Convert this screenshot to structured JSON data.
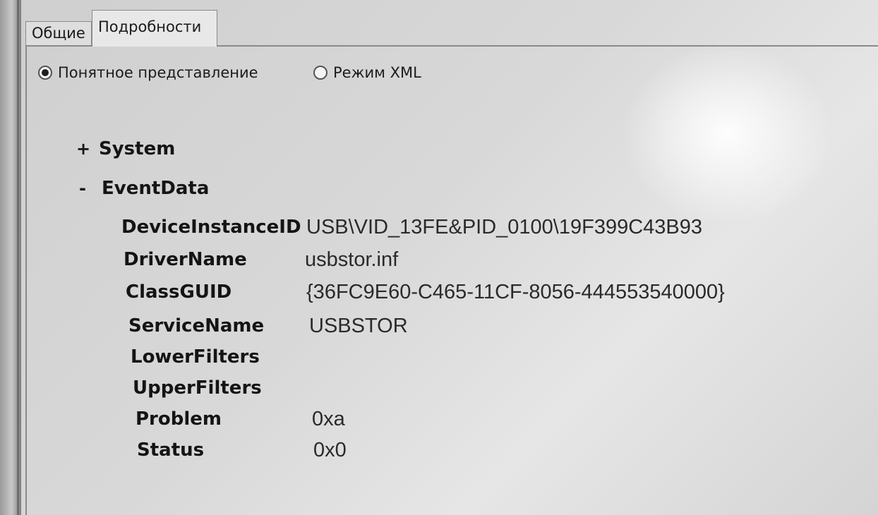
{
  "tabs": {
    "general_label": "Общие",
    "details_label": "Подробности"
  },
  "view_mode": {
    "friendly_label": "Понятное представление",
    "xml_label": "Режим XML",
    "selected": "friendly"
  },
  "tree": {
    "system": {
      "sign": "+",
      "label": "System"
    },
    "eventdata": {
      "sign": "-",
      "label": "EventData",
      "fields": [
        {
          "name": "DeviceInstanceID",
          "value": "USB\\VID_13FE&PID_0100\\19F399C43B93"
        },
        {
          "name": "DriverName",
          "value": "usbstor.inf"
        },
        {
          "name": "ClassGUID",
          "value": "{36FC9E60-C465-11CF-8056-444553540000}"
        },
        {
          "name": "ServiceName",
          "value": "USBSTOR"
        },
        {
          "name": "LowerFilters",
          "value": ""
        },
        {
          "name": "UpperFilters",
          "value": ""
        },
        {
          "name": "Problem",
          "value": "0xa"
        },
        {
          "name": "Status",
          "value": "0x0"
        }
      ]
    }
  }
}
